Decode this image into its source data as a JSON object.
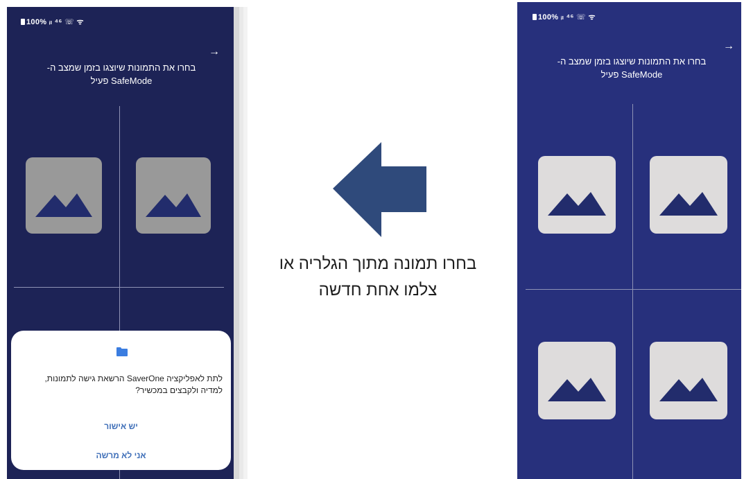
{
  "left_screen": {
    "status_text": "100% ᵢₗ ⁴⁶ ☏ ᯤ",
    "back_arrow": "→",
    "title_line1": "בחרו את התמונות שיוצגו בזמן שמצב ה-",
    "title_line2": "SafeMode פעיל",
    "dialog": {
      "icon": "folder-icon",
      "message_line1": "לתת לאפליקציה SaverOne הרשאת גישה לתמונות,",
      "message_line2": "למדיה ולקבצים במכשיר?",
      "allow_label": "יש אישור",
      "deny_label": "אני לא מרשה"
    }
  },
  "caption": {
    "line1": "בחרו תמונה מתוך הגלריה או",
    "line2": "צלמו אחת חדשה"
  },
  "right_screen": {
    "status_text": "100% ᵢₗ ⁴⁶ ☏ ᯤ",
    "back_arrow": "→",
    "title_line1": "בחרו את התמונות שיוצגו בזמן שמצב ה-",
    "title_line2": "SafeMode פעיל"
  },
  "colors": {
    "left_bg": "#1d2356",
    "right_bg": "#27307c",
    "arrow": "#2f4a7b",
    "dialog_button": "#3f6fb8",
    "mountain": "#222c6c"
  }
}
